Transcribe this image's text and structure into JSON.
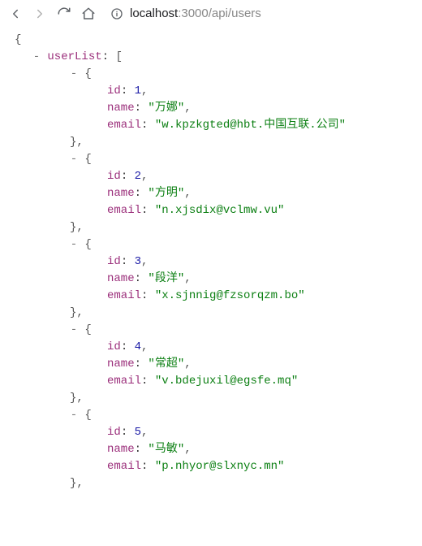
{
  "browser": {
    "url_host": "localhost",
    "url_port": ":3000",
    "url_path": "/api/users"
  },
  "root_key": "userList",
  "keys": {
    "id": "id",
    "name": "name",
    "email": "email"
  },
  "items": [
    {
      "id": 1,
      "name": "万娜",
      "email": "w.kpzkgted@hbt.中国互联.公司"
    },
    {
      "id": 2,
      "name": "方明",
      "email": "n.xjsdix@vclmw.vu"
    },
    {
      "id": 3,
      "name": "段洋",
      "email": "x.sjnnig@fzsorqzm.bo"
    },
    {
      "id": 4,
      "name": "常超",
      "email": "v.bdejuxil@egsfe.mq"
    },
    {
      "id": 5,
      "name": "马敏",
      "email": "p.nhyor@slxnyc.mn"
    }
  ]
}
